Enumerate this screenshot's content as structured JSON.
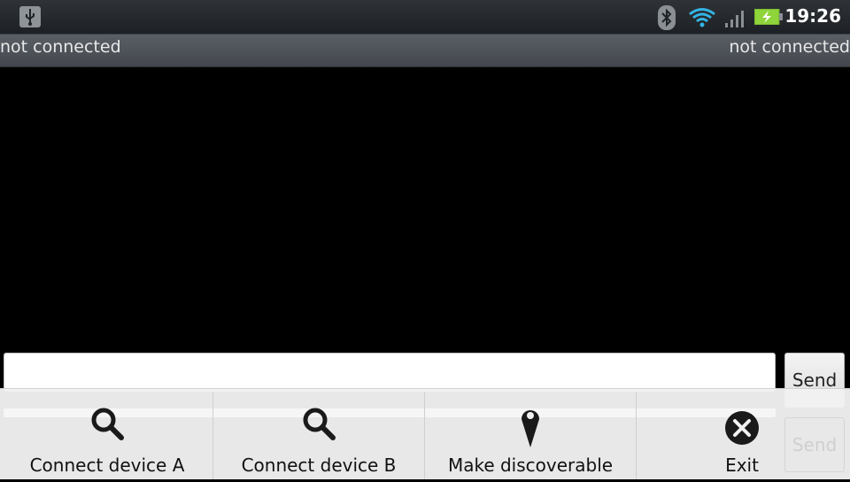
{
  "status_bar": {
    "time": "19:26",
    "icons": [
      "usb-icon",
      "bluetooth-icon",
      "wifi-icon",
      "signal-icon",
      "battery-charging-icon"
    ]
  },
  "connection": {
    "left_status": "not connected",
    "right_status": "not connected"
  },
  "composer": {
    "input_value": "",
    "send_label": "Send",
    "ghost_send_label": "Send"
  },
  "menu": {
    "items": [
      {
        "label": "Connect device A",
        "icon": "search-icon"
      },
      {
        "label": "Connect device B",
        "icon": "search-icon"
      },
      {
        "label": "Make discoverable",
        "icon": "location-pin-icon"
      },
      {
        "label": "Exit",
        "icon": "close-icon"
      }
    ]
  },
  "colors": {
    "status_bar": "#2f3338",
    "title_bar": "#4f5359",
    "menu_bg": "#f1f1f1",
    "wifi_blue": "#33b5e5",
    "battery_green": "#8ed43a"
  }
}
